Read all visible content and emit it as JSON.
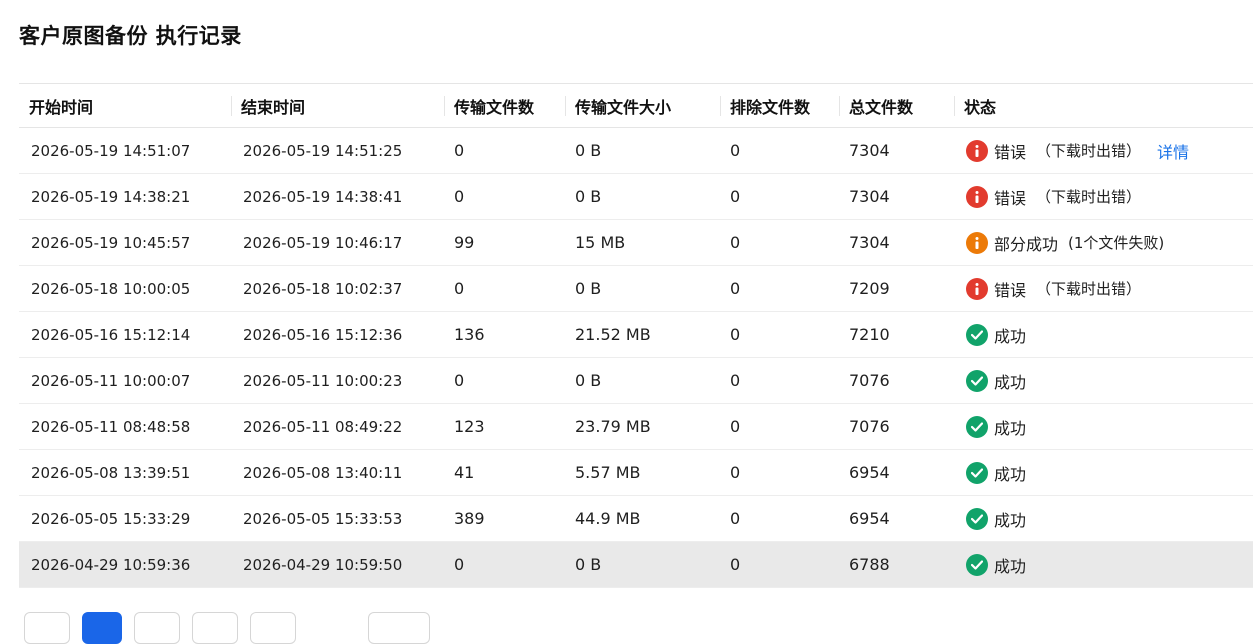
{
  "page": {
    "title": "客户原图备份 执行记录"
  },
  "table": {
    "headers": [
      "开始时间",
      "结束时间",
      "传输文件数",
      "传输文件大小",
      "排除文件数",
      "总文件数",
      "状态"
    ],
    "rows": [
      {
        "start": "2026-05-19 14:51:07",
        "end": "2026-05-19 14:51:25",
        "transferred": "0",
        "size": "0 B",
        "excluded": "0",
        "total": "7304",
        "status_kind": "error",
        "status": "错误",
        "reason": "（下载时出错）",
        "link": "详情"
      },
      {
        "start": "2026-05-19 14:38:21",
        "end": "2026-05-19 14:38:41",
        "transferred": "0",
        "size": "0 B",
        "excluded": "0",
        "total": "7304",
        "status_kind": "error",
        "status": "错误",
        "reason": "（下载时出错）",
        "link": ""
      },
      {
        "start": "2026-05-19 10:45:57",
        "end": "2026-05-19 10:46:17",
        "transferred": "99",
        "size": "15 MB",
        "excluded": "0",
        "total": "7304",
        "status_kind": "partial",
        "status": "部分成功",
        "reason": "(1个文件失败)",
        "link": ""
      },
      {
        "start": "2026-05-18 10:00:05",
        "end": "2026-05-18 10:02:37",
        "transferred": "0",
        "size": "0 B",
        "excluded": "0",
        "total": "7209",
        "status_kind": "error",
        "status": "错误",
        "reason": "（下载时出错）",
        "link": ""
      },
      {
        "start": "2026-05-16 15:12:14",
        "end": "2026-05-16 15:12:36",
        "transferred": "136",
        "size": "21.52 MB",
        "excluded": "0",
        "total": "7210",
        "status_kind": "success",
        "status": "成功",
        "reason": "",
        "link": ""
      },
      {
        "start": "2026-05-11 10:00:07",
        "end": "2026-05-11 10:00:23",
        "transferred": "0",
        "size": "0 B",
        "excluded": "0",
        "total": "7076",
        "status_kind": "success",
        "status": "成功",
        "reason": "",
        "link": ""
      },
      {
        "start": "2026-05-11 08:48:58",
        "end": "2026-05-11 08:49:22",
        "transferred": "123",
        "size": "23.79 MB",
        "excluded": "0",
        "total": "7076",
        "status_kind": "success",
        "status": "成功",
        "reason": "",
        "link": ""
      },
      {
        "start": "2026-05-08 13:39:51",
        "end": "2026-05-08 13:40:11",
        "transferred": "41",
        "size": "5.57 MB",
        "excluded": "0",
        "total": "6954",
        "status_kind": "success",
        "status": "成功",
        "reason": "",
        "link": ""
      },
      {
        "start": "2026-05-05 15:33:29",
        "end": "2026-05-05 15:33:53",
        "transferred": "389",
        "size": "44.9 MB",
        "excluded": "0",
        "total": "6954",
        "status_kind": "success",
        "status": "成功",
        "reason": "",
        "link": ""
      },
      {
        "start": "2026-04-29 10:59:36",
        "end": "2026-04-29 10:59:50",
        "transferred": "0",
        "size": "0 B",
        "excluded": "0",
        "total": "6788",
        "status_kind": "success",
        "status": "成功",
        "reason": "",
        "link": "",
        "highlighted": true
      }
    ]
  },
  "icons": {
    "error": "error-info-icon",
    "partial": "warning-info-icon",
    "success": "success-check-icon"
  },
  "colors": {
    "error": "#e23b2e",
    "partial": "#ec7a08",
    "success": "#11a36a",
    "link": "#1a73e8",
    "active_page": "#1a66e8"
  }
}
